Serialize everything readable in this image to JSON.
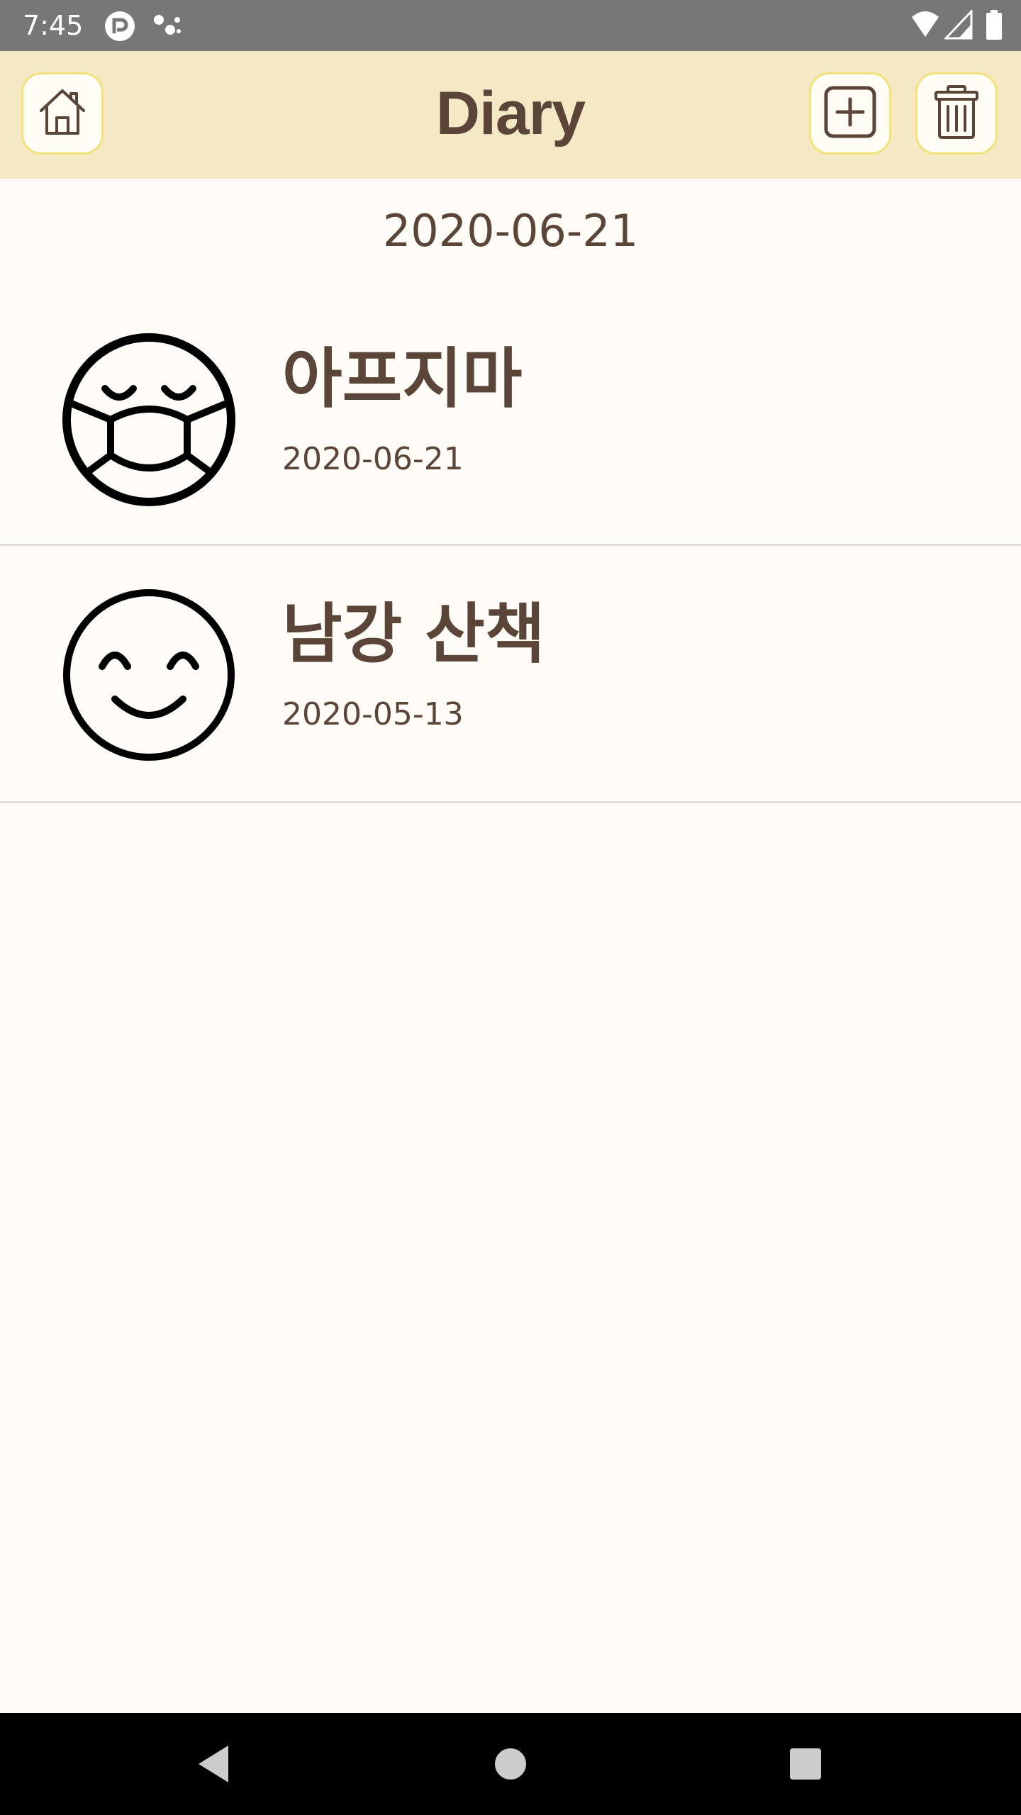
{
  "status_bar": {
    "time": "7:45",
    "icons": [
      "app-notification-icon",
      "assistant-dots-icon",
      "wifi-icon",
      "signal-icon",
      "battery-icon"
    ]
  },
  "app_bar": {
    "title": "Diary",
    "home_icon": "home-icon",
    "add_icon": "add-square-icon",
    "delete_icon": "trash-icon",
    "background_color": "#F5E8C5",
    "button_border_color": "#F1E27A"
  },
  "date_header": "2020-06-21",
  "entries": [
    {
      "title": "아프지마",
      "date": "2020-06-21",
      "mood_icon": "sick-mask-face-icon"
    },
    {
      "title": "남강 산책",
      "date": "2020-05-13",
      "mood_icon": "smiling-face-icon"
    }
  ],
  "nav_bar": {
    "icons": [
      "back-triangle-icon",
      "home-circle-icon",
      "recents-square-icon"
    ]
  },
  "colors": {
    "text": "#5B4538",
    "background": "#FFFCF7",
    "divider": "#DDDDDD"
  }
}
